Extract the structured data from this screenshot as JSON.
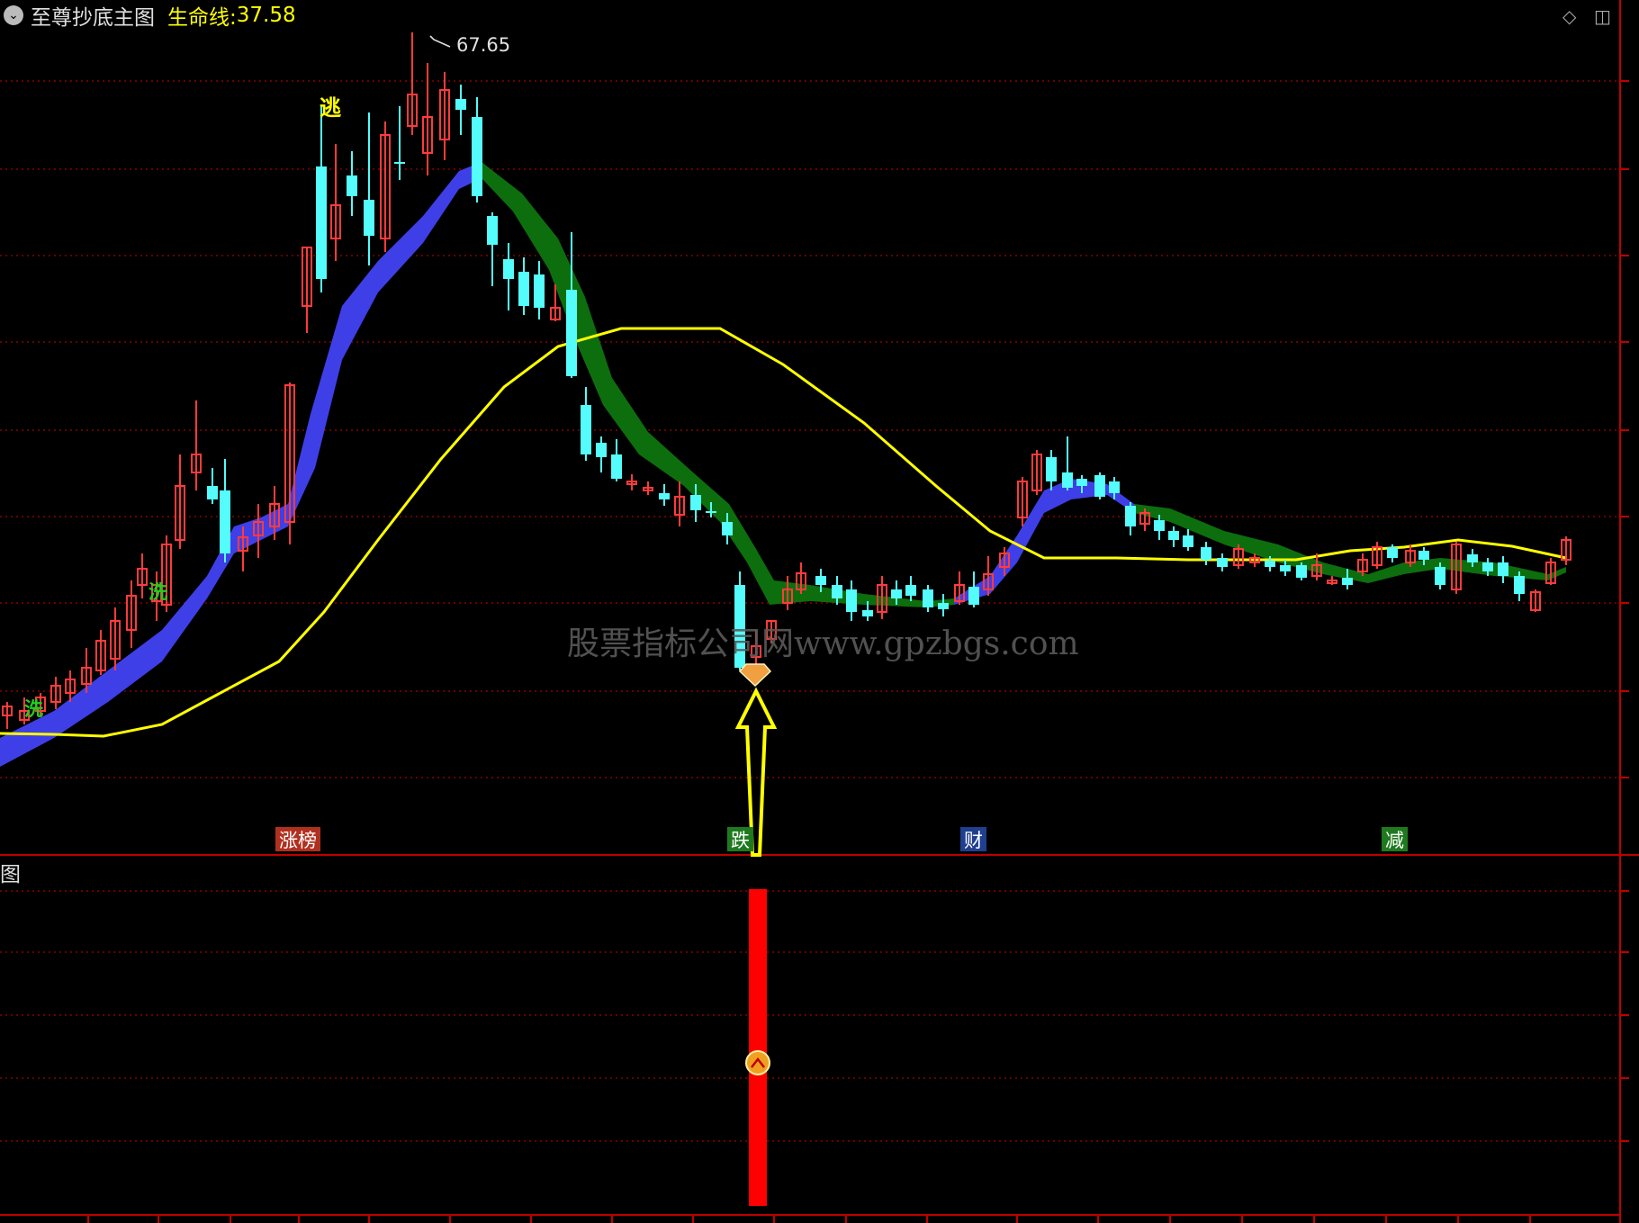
{
  "header": {
    "title": "至尊抄底主图",
    "indicator_label": "生命线:",
    "indicator_value": "37.58"
  },
  "price_high_label": "67.65",
  "signals": {
    "escape": "逃",
    "wash_1": "洗",
    "wash_2": "洗"
  },
  "event_tags": [
    {
      "text": "涨榜",
      "color": "#b03020"
    },
    {
      "text": "跌",
      "color": "#1f7a1f"
    },
    {
      "text": "财",
      "color": "#1f3f8f"
    },
    {
      "text": "减",
      "color": "#1f7a1f"
    }
  ],
  "sub_panel_label": "图",
  "watermark": "股票指标公司网www.gpzbgs.com",
  "colors": {
    "bull": "#ff3b3b",
    "bear": "#54fcfc",
    "lifeline": "#ffff00",
    "band_up": "#3f3fe8",
    "band_down": "#0d6e0d",
    "grid": "#8b0000",
    "separator": "#c00000"
  },
  "icons": [
    "collapse-icon",
    "diamond-icon",
    "window-icon",
    "diamond-gem-icon",
    "up-arrow-icon",
    "up-chevron-icon"
  ]
}
